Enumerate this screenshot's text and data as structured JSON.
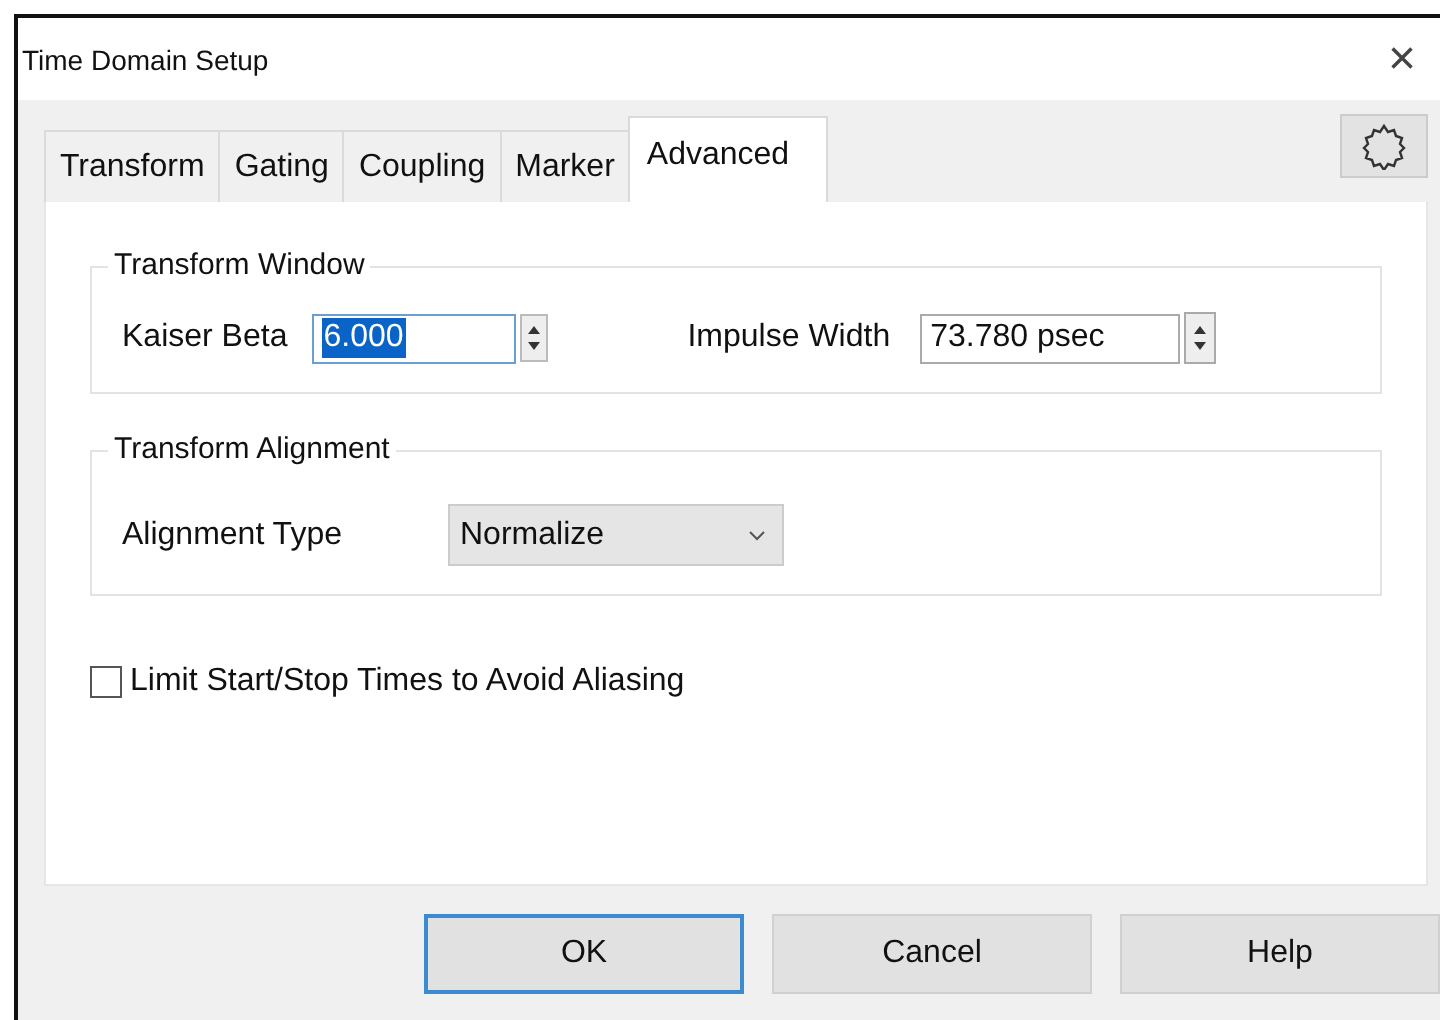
{
  "window": {
    "title": "Time Domain Setup",
    "close": "×"
  },
  "tabs": [
    {
      "label": "Transform",
      "selected": false
    },
    {
      "label": "Gating",
      "selected": false
    },
    {
      "label": "Coupling",
      "selected": false
    },
    {
      "label": "Marker",
      "selected": false
    },
    {
      "label": "Advanced",
      "selected": true
    }
  ],
  "transform_window": {
    "title": "Transform Window",
    "kaiser_beta": {
      "label": "Kaiser Beta",
      "value": "6.000",
      "text_selected": true
    },
    "impulse_width": {
      "label": "Impulse Width",
      "value": "73.780 psec",
      "text_selected": false
    }
  },
  "transform_alignment": {
    "title": "Transform Alignment",
    "alignment_type": {
      "label": "Alignment Type",
      "value": "Normalize"
    }
  },
  "limit_checkbox": {
    "label": "Limit Start/Stop Times to Avoid Aliasing",
    "checked": false
  },
  "buttons": [
    {
      "label": "OK",
      "default": true
    },
    {
      "label": "Cancel",
      "default": false
    },
    {
      "label": "Help",
      "default": false
    }
  ]
}
